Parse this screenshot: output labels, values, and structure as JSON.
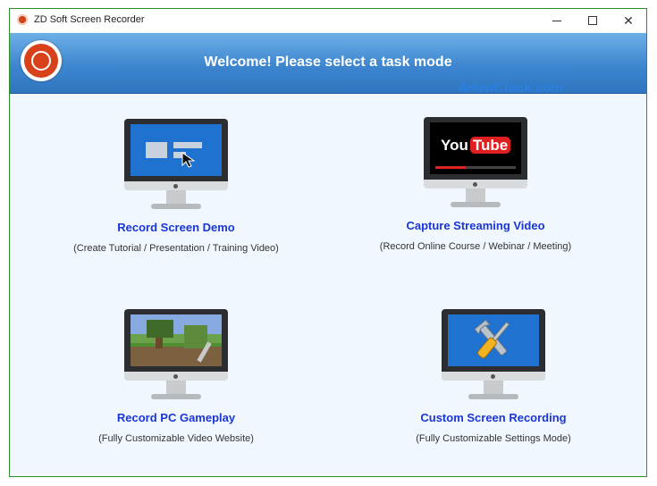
{
  "window": {
    "title": "ZD Soft Screen Recorder",
    "buttons": {
      "minimize": "minimize",
      "maximize": "maximize",
      "close": "✕"
    }
  },
  "banner": {
    "welcome": "Welcome! Please select a task mode",
    "watermark": "4HowCrack.com"
  },
  "tasks": [
    {
      "title": "Record Screen Demo",
      "desc": "(Create Tutorial / Presentation / Training Video)",
      "icon": "screen-demo-monitor-icon"
    },
    {
      "title": "Capture Streaming Video",
      "desc": "(Record Online Course / Webinar / Meeting)",
      "icon": "youtube-monitor-icon"
    },
    {
      "title": "Record PC Gameplay",
      "desc": "(Fully Customizable Video Website)",
      "icon": "gameplay-monitor-icon"
    },
    {
      "title": "Custom Screen Recording",
      "desc": "(Fully Customizable Settings Mode)",
      "icon": "tools-monitor-icon"
    }
  ],
  "youtube": {
    "you": "You",
    "tube": "Tube"
  },
  "colors": {
    "accent": "#1a35d8",
    "banner": "#3d86cf",
    "window_border": "#2f8f2f",
    "background": "#f0f7fe"
  }
}
